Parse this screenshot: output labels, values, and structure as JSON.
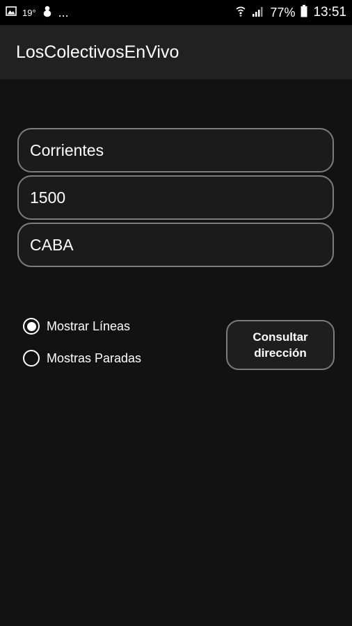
{
  "status_bar": {
    "temperature": "19°",
    "more": "...",
    "battery_percent": "77%",
    "time": "13:51"
  },
  "app_bar": {
    "title": "LosColectivosEnVivo"
  },
  "form": {
    "street": "Corrientes",
    "number": "1500",
    "city": "CABA"
  },
  "options": {
    "show_lines_label": "Mostrar Líneas",
    "show_stops_label": "Mostras Paradas",
    "selected": "show_lines"
  },
  "actions": {
    "consult_line1": "Consultar",
    "consult_line2": "dirección"
  }
}
